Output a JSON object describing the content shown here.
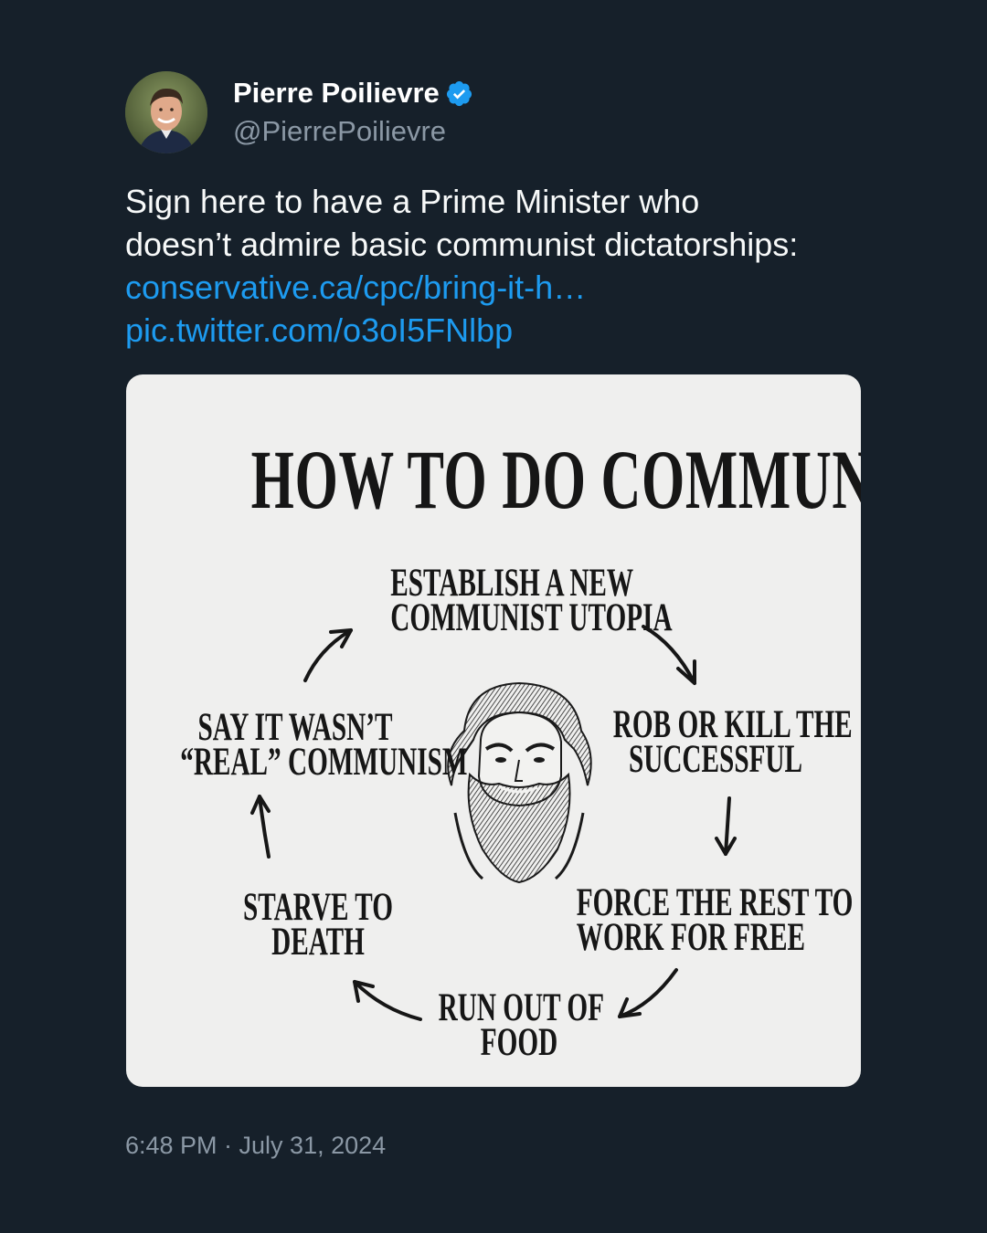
{
  "author": {
    "display_name": "Pierre Poilievre",
    "handle": "@PierrePoilievre",
    "verified": true,
    "verified_icon": "verified-badge-icon",
    "verified_color": "#1d9bf0"
  },
  "tweet": {
    "text_line_1": "Sign here to have a Prime Minister who",
    "text_line_2": "doesn’t admire basic communist dictatorships:",
    "link_1": "conservative.ca/cpc/bring-it-h…",
    "link_2": "pic.twitter.com/o3oI5FNlbp"
  },
  "media": {
    "headline": "HOW TO DO COMMUNISM",
    "steps": {
      "establish": [
        "ESTABLISH A NEW",
        "COMMUNIST UTOPIA"
      ],
      "rob": [
        "ROB OR KILL THE",
        "SUCCESSFUL"
      ],
      "force": [
        "FORCE THE REST TO",
        "WORK FOR FREE"
      ],
      "run_out": [
        "RUN OUT OF",
        "FOOD"
      ],
      "starve": [
        "STARVE TO",
        "DEATH"
      ],
      "say": [
        "SAY IT WASN’T",
        "“REAL” COMMUNISM"
      ]
    }
  },
  "timestamp": "6:48 PM · July 31, 2024",
  "colors": {
    "background": "#16202a",
    "link": "#1d9bf0",
    "secondary_text": "#8b98a5"
  }
}
